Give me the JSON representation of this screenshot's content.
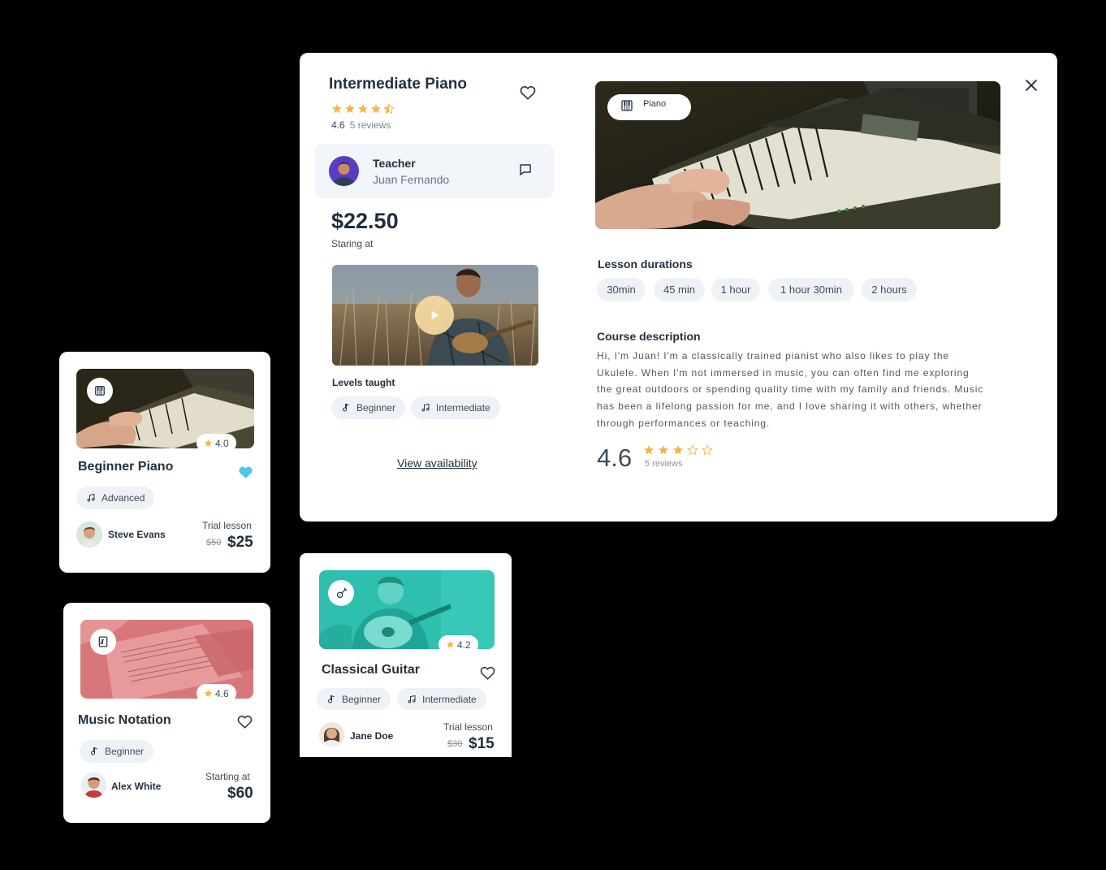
{
  "detail": {
    "title": "Intermediate Piano",
    "rating": "4.6",
    "reviews": "5 reviews",
    "teacher_label": "Teacher",
    "teacher_name": "Juan Fernando",
    "price": "$22.50",
    "price_caption": "Staring at",
    "levels_label": "Levels taught",
    "levels": [
      "Beginner",
      "Intermediate"
    ],
    "view_availability": "View availability",
    "instrument_chip": "Piano",
    "lesson_durations_title": "Lesson durations",
    "durations": [
      "30min",
      "45 min",
      "1 hour",
      "1 hour 30min",
      "2 hours"
    ],
    "course_description_title": "Course description",
    "description_lines": [
      "Hi, I'm Juan! I'm a classically trained pianist who also likes to play the",
      "Ukulele. When I'm not immersed in music, you can often find me exploring",
      "the great outdoors or spending quality time with my family and friends. Music",
      "has been a lifelong passion for me, and I love sharing it with others, whether",
      "through performances or teaching."
    ],
    "big_rating": "4.6",
    "big_rating_reviews": "5 reviews",
    "star_color": "#f5b547"
  },
  "cards": [
    {
      "title": "Beginner Piano",
      "rating": "4.0",
      "level": "Advanced",
      "teacher": "Steve Evans",
      "price_label": "Trial lesson",
      "old_price": "$50",
      "price": "$25",
      "favorited": true,
      "heart_color": "#4fc3e8",
      "icon": "piano-icon"
    },
    {
      "title": "Music Notation",
      "rating": "4.6",
      "level": "Beginner",
      "teacher": "Alex White",
      "price_label": "Starting at",
      "price": "$60",
      "favorited": false,
      "icon": "sheet-music-icon"
    },
    {
      "title": "Classical Guitar",
      "rating": "4.2",
      "levels": [
        "Beginner",
        "Intermediate"
      ],
      "teacher": "Jane Doe",
      "price_label": "Trial lesson",
      "old_price": "$30",
      "price": "$15",
      "favorited": false,
      "icon": "guitar-icon"
    }
  ]
}
